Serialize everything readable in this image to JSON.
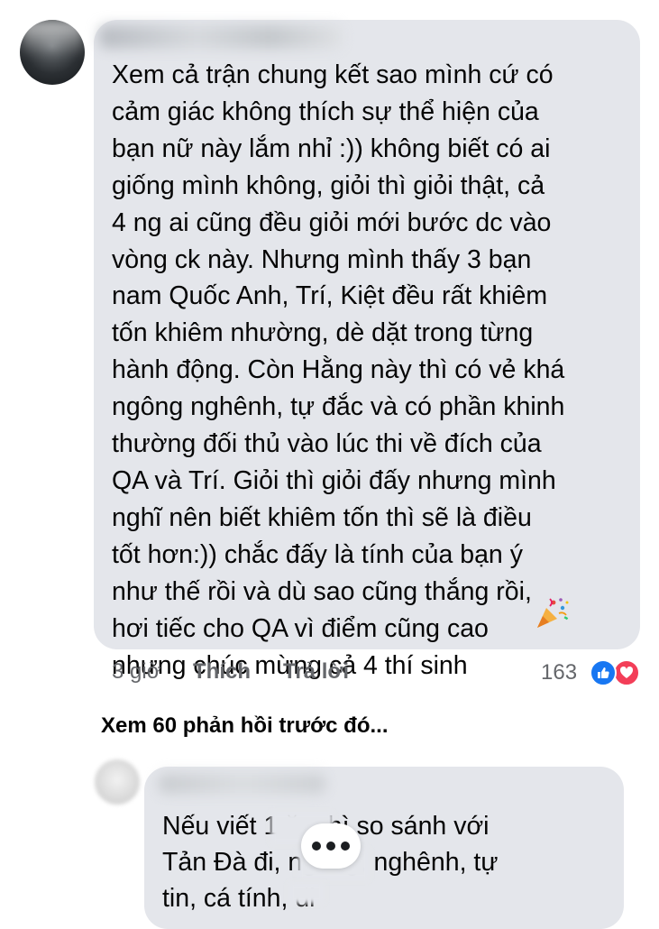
{
  "comment": {
    "text": "Xem cả trận chung kết sao mình cứ có\ncảm giác không thích sự thể hiện của\nbạn nữ này lắm nhỉ :)) không biết có ai\ngiống mình không, giỏi thì giỏi thật, cả\n4 ng ai cũng đều giỏi mới bước dc vào\nvòng ck này. Nhưng mình thấy 3 bạn\nnam Quốc Anh, Trí, Kiệt đều rất khiêm\ntốn khiêm nhường, dè dặt trong từng\nhành động. Còn Hằng này thì có vẻ khá\nngông nghênh, tự đắc và có phần khinh\nthường đối thủ vào lúc thi về đích của\nQA và Trí. Giỏi thì giỏi đấy nhưng mình\nnghĩ nên biết khiêm tốn thì sẽ là điều\ntốt hơn:)) chắc đấy là tính của bạn ý\nnhư thế rồi và dù sao cũng thắng rồi,\nhơi tiếc cho QA vì điểm cũng cao\nnhưng chúc mừng cả 4 thí sinh",
    "emoji_icon": "party-popper-icon",
    "time": "3 giờ",
    "like_label": "Thích",
    "reply_label": "Trả lời",
    "reaction_count": "163",
    "reactions": [
      "like-icon",
      "love-icon"
    ],
    "colors": {
      "like": "#1877f2",
      "love": "#f33e58",
      "bubble": "#e4e6eb",
      "meta": "#65676b"
    }
  },
  "view_previous": "Xem 60 phản hồi trước đó...",
  "reply": {
    "text": "Nếu viết 1         ăn thì so sánh với\nTản Đà đi,          ngông, nghênh, tự\ntin, cá tính,      đi"
  }
}
